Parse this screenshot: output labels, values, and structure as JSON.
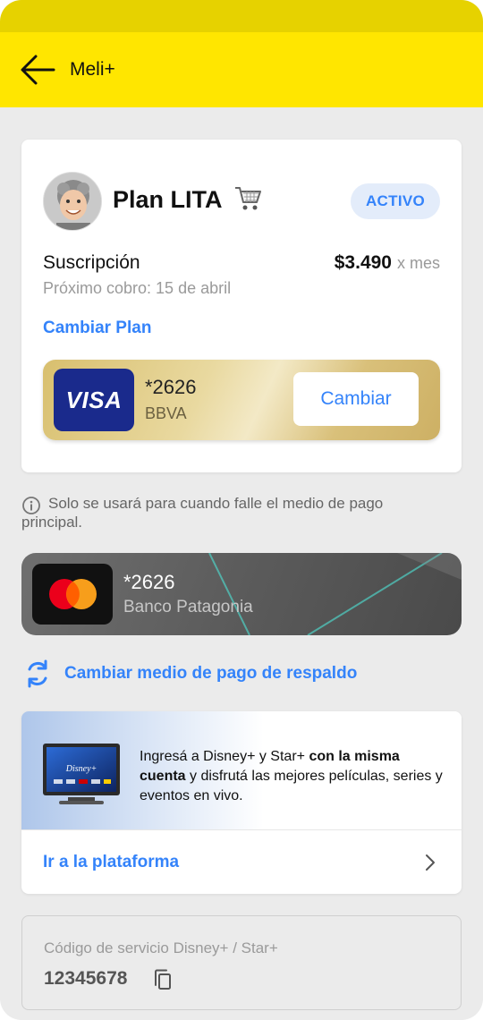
{
  "appbar": {
    "title": "Meli+"
  },
  "plan": {
    "name": "Plan LITA",
    "status": "ACTIVO",
    "subscription_label": "Suscripción",
    "price": "$3.490",
    "price_period": "x mes",
    "next_charge": "Próximo cobro: 15 de abril",
    "change_plan_label": "Cambiar Plan"
  },
  "primary_card": {
    "brand": "VISA",
    "number": "*2626",
    "bank": "BBVA",
    "change_label": "Cambiar"
  },
  "backup_info": {
    "line1": "Solo se usará para cuando falle el medio de pago",
    "line2": "principal."
  },
  "backup_card": {
    "number": "*2626",
    "bank": "Banco Patagonia"
  },
  "backup_action": {
    "label": "Cambiar medio de pago de respaldo"
  },
  "promo": {
    "text_a": "Ingresá a Disney+ y Star+ ",
    "text_b": "con la misma cuenta",
    "text_c": " y disfrutá las mejores películas, series y eventos en vivo.",
    "link_label": "Ir a la plataforma",
    "tv_brand": "Disney+"
  },
  "service_code": {
    "label": "Código de servicio Disney+ / Star+",
    "value": "12345678"
  },
  "colors": {
    "accent_blue": "#3483fa",
    "meli_yellow": "#ffe600",
    "visa_blue": "#1a2a8c"
  },
  "icons": {
    "back": "arrow-left-icon",
    "cart": "shopping-cart-icon",
    "info": "info-circle-icon",
    "refresh": "refresh-icon",
    "chevron": "chevron-right-icon",
    "copy": "copy-icon"
  }
}
